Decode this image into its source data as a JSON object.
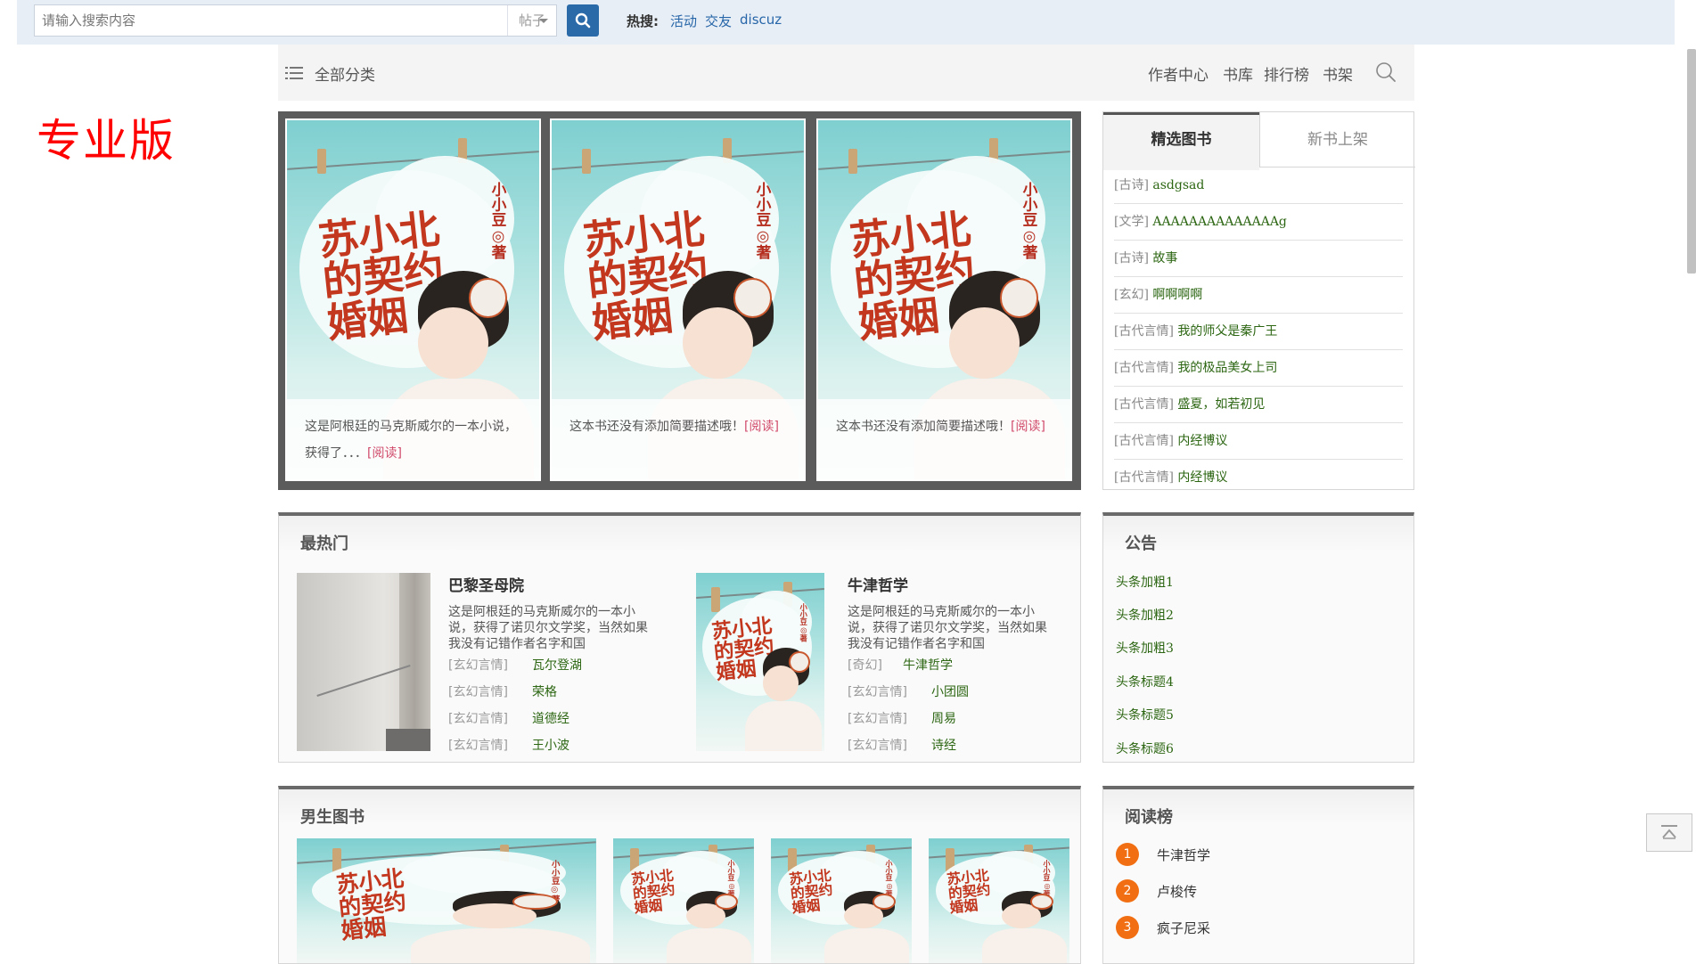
{
  "search": {
    "placeholder": "请输入搜索内容",
    "type_selected": "帖子",
    "hot_label": "热搜:",
    "hot_links": [
      "活动",
      "交友",
      "discuz"
    ]
  },
  "nav": {
    "all_categories": "全部分类",
    "links": [
      "作者中心",
      "书库",
      "排行榜",
      "书架"
    ]
  },
  "edition_label": "专业版",
  "cover_book": {
    "title_lines": [
      "苏小北",
      "的契约",
      "婚姻"
    ],
    "author": "小小豆◎著"
  },
  "carousel": {
    "slides": [
      {
        "desc": "这是阿根廷的马克斯威尔的一本小说，获得了．．．",
        "read": "[阅读]"
      },
      {
        "desc": "这本书还没有添加简要描述哦！",
        "read": "[阅读]"
      },
      {
        "desc": "这本书还没有添加简要描述哦！",
        "read": "[阅读]"
      }
    ]
  },
  "tabs": {
    "active": "精选图书",
    "inactive": "新书上架",
    "items": [
      {
        "cat": "[古诗]",
        "name": "asdgsad"
      },
      {
        "cat": "[文学]",
        "name": "AAAAAAAAAAAAAAg"
      },
      {
        "cat": "[古诗]",
        "name": "故事"
      },
      {
        "cat": "[玄幻]",
        "name": "啊啊啊啊"
      },
      {
        "cat": "[古代言情]",
        "name": "我的师父是秦广王"
      },
      {
        "cat": "[古代言情]",
        "name": "我的极品美女上司"
      },
      {
        "cat": "[古代言情]",
        "name": "盛夏，如若初见"
      },
      {
        "cat": "[古代言情]",
        "name": "内经博议"
      },
      {
        "cat": "[古代言情]",
        "name": "内经博议"
      }
    ]
  },
  "hot": {
    "title": "最热门",
    "cards": [
      {
        "name": "巴黎圣母院",
        "desc": "这是阿根廷的马克斯威尔的一本小说，获得了诺贝尔文学奖，当然如果我没有记错作者名字和国",
        "subs": [
          {
            "cat": "[玄幻言情]",
            "name": "瓦尔登湖"
          },
          {
            "cat": "[玄幻言情]",
            "name": "荣格"
          },
          {
            "cat": "[玄幻言情]",
            "name": "道德经"
          },
          {
            "cat": "[玄幻言情]",
            "name": "王小波"
          }
        ]
      },
      {
        "name": "牛津哲学",
        "desc": "这是阿根廷的马克斯威尔的一本小说，获得了诺贝尔文学奖，当然如果我没有记错作者名字和国",
        "subs": [
          {
            "cat": "[奇幻]",
            "name": "牛津哲学"
          },
          {
            "cat": "[玄幻言情]",
            "name": "小团圆"
          },
          {
            "cat": "[玄幻言情]",
            "name": "周易"
          },
          {
            "cat": "[玄幻言情]",
            "name": "诗经"
          }
        ]
      }
    ]
  },
  "notice": {
    "title": "公告",
    "items": [
      "头条加粗1",
      "头条加粗2",
      "头条加粗3",
      "头条标题4",
      "头条标题5",
      "头条标题6"
    ]
  },
  "male_books": {
    "title": "男生图书"
  },
  "ranking": {
    "title": "阅读榜",
    "items": [
      {
        "rank": "1",
        "name": "牛津哲学"
      },
      {
        "rank": "2",
        "name": "卢梭传"
      },
      {
        "rank": "3",
        "name": "疯子尼采"
      }
    ]
  },
  "colors": {
    "accent_blue": "#2a6aa8",
    "link_green": "#2c6612",
    "rank_orange": "#f16f12",
    "edition_red": "#ff0000"
  }
}
